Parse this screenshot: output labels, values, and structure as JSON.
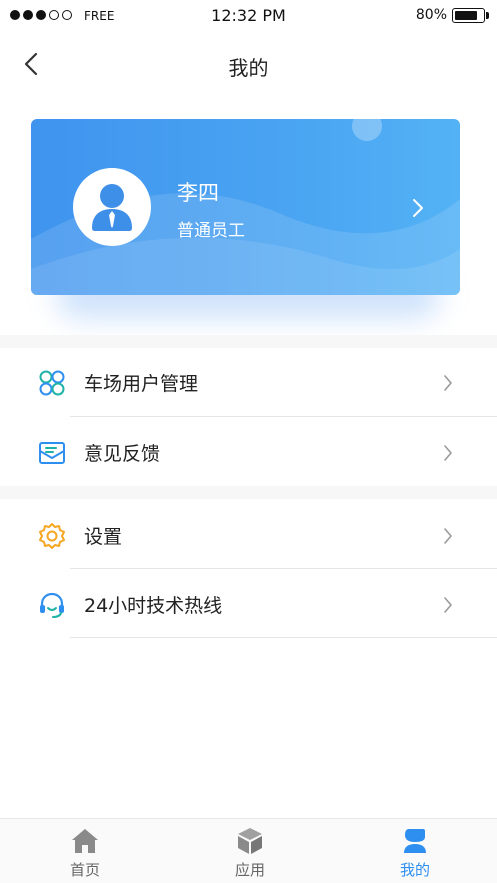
{
  "status_bar": {
    "carrier": "FREE",
    "time": "12:32 PM",
    "battery_percent": "80%",
    "battery_level": 0.8,
    "signal_bars_filled": 3,
    "signal_bars_total": 5
  },
  "nav": {
    "title": "我的",
    "back_icon": "chevron-left-icon"
  },
  "profile": {
    "name": "李四",
    "role": "普通员工",
    "avatar_icon": "user-avatar-icon",
    "card_color_start": "#3f94ee",
    "card_color_end": "#53b2f5"
  },
  "menu_groups": [
    {
      "items": [
        {
          "label": "车场用户管理",
          "icon": "four-petal-icon"
        },
        {
          "label": "意见反馈",
          "icon": "envelope-icon"
        }
      ]
    },
    {
      "items": [
        {
          "label": "设置",
          "icon": "gear-icon"
        },
        {
          "label": "24小时技术热线",
          "icon": "headset-icon"
        }
      ]
    }
  ],
  "tab_bar": {
    "active_index": 2,
    "active_color": "#2f8ff0",
    "inactive_color": "#666666",
    "tabs": [
      {
        "label": "首页",
        "icon": "home-icon"
      },
      {
        "label": "应用",
        "icon": "cube-icon"
      },
      {
        "label": "我的",
        "icon": "user-icon"
      }
    ]
  }
}
